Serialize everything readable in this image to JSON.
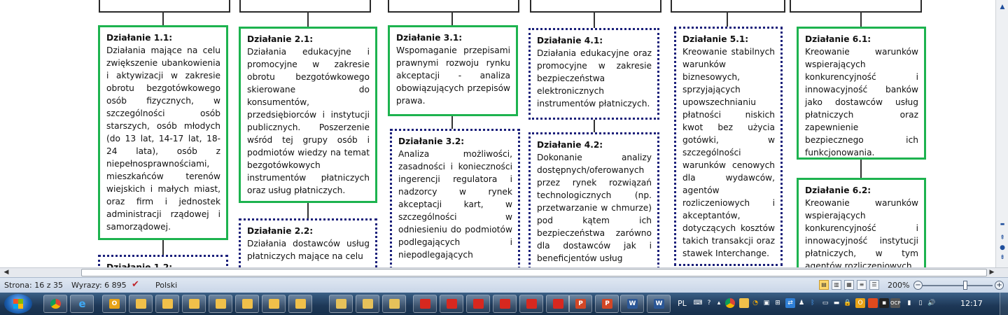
{
  "document": {
    "boxes": [
      {
        "title": "Działanie 1.1:",
        "text": "Działania mające na celu zwiększenie ubankowienia i aktywizacji w zakresie obrotu bezgotówkowego osób fizycznych, w szczególności osób starszych, osób młodych (do 13 lat, 14-17 lat, 18-24 lata), osób z niepełnosprawnościami, mieszkańców terenów wiejskich i małych miast, oraz firm i jednostek administracji rządowej i samorządowej.",
        "style": "green"
      },
      {
        "title": "Działanie 1.2:",
        "text": "",
        "style": "blue"
      },
      {
        "title": "Działanie 2.1:",
        "text": "Działania edukacyjne i promocyjne w zakresie obrotu bezgotówkowego skierowane do konsumentów, przedsiębiorców i instytucji publicznych. Poszerzenie wśród tej grupy osób i podmiotów wiedzy na temat bezgotówkowych instrumentów płatniczych oraz usług płatniczych.",
        "style": "green"
      },
      {
        "title": "Działanie 2.2:",
        "text": "Działania dostawców usług płatniczych mające na celu",
        "style": "blue"
      },
      {
        "title": "Działanie 3.1:",
        "text": "Wspomaganie przepisami prawnymi rozwoju rynku akceptacji - analiza obowiązujących przepisów prawa.",
        "style": "green"
      },
      {
        "title": "Działanie 3.2:",
        "text": "Analiza możliwości, zasadności i konieczności ingerencji regulatora i nadzorcy w rynek akceptacji kart, w szczególności w odniesieniu do podmiotów podlegających i niepodlegających",
        "style": "blue"
      },
      {
        "title": "Działanie 4.1:",
        "text": "Działania edukacyjne oraz promocyjne w zakresie bezpieczeństwa elektronicznych instrumentów płatniczych.",
        "style": "blue"
      },
      {
        "title": "Działanie 4.2:",
        "text": "Dokonanie analizy dostępnych/oferowanych przez rynek rozwiązań technologicznych (np. przetwarzanie w chmurze) pod kątem ich bezpieczeństwa zarówno dla dostawców jak i beneficjentów usług",
        "style": "blue"
      },
      {
        "title": "Działanie 5.1:",
        "text": "Kreowanie stabilnych warunków biznesowych, sprzyjających upowszechnianiu płatności niskich kwot bez użycia gotówki, w szczególności warunków cenowych dla wydawców, agentów rozliczeniowych i akceptantów, dotyczących kosztów takich transakcji oraz stawek Interchange.",
        "style": "blue"
      },
      {
        "title": "Działanie 6.1:",
        "text": "Kreowanie warunków wspierających konkurencyjność i innowacyjność banków jako dostawców usług płatniczych oraz zapewnienie bezpiecznego ich funkcjonowania.",
        "style": "green"
      },
      {
        "title": "Działanie 6.2:",
        "text": "Kreowanie warunków wspierających konkurencyjność i innowacyjność instytucji płatniczych, w tym agentów rozliczeniowych",
        "style": "green"
      }
    ]
  },
  "statusbar": {
    "page": "Strona: 16 z 35",
    "words": "Wyrazy: 6 895",
    "language": "Polski",
    "zoom": "200%"
  },
  "taskbar": {
    "lang": "PL",
    "clock": "12:17"
  },
  "colors": {
    "green_border": "#1db34f",
    "blue_border": "#1a1f7a"
  }
}
